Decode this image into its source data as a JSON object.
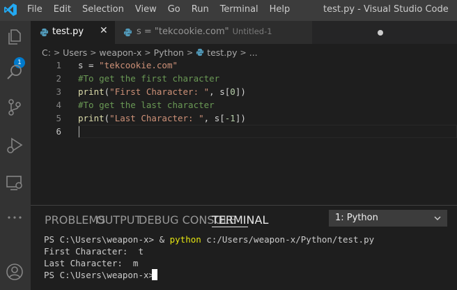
{
  "window": {
    "title": "test.py - Visual Studio Code"
  },
  "menu": [
    "File",
    "Edit",
    "Selection",
    "View",
    "Go",
    "Run",
    "Terminal",
    "Help"
  ],
  "activity_bar": {
    "items": [
      "explorer-icon",
      "search-icon",
      "source-control-icon",
      "run-debug-icon",
      "remote-explorer-icon",
      "extensions-icon",
      "account-icon"
    ],
    "explorer_badge": "1"
  },
  "tabs": [
    {
      "label": "test.py",
      "active": true
    },
    {
      "label": "s = \"tekcookie.com\"",
      "sub": "Untitled-1",
      "active": false,
      "dirty": true
    }
  ],
  "breadcrumb": [
    "C:",
    "Users",
    "weapon-x",
    "Python",
    "test.py",
    "..."
  ],
  "editor": {
    "line_numbers": [
      "1",
      "2",
      "3",
      "4",
      "5",
      "6"
    ],
    "lines": [
      {
        "t1": "s = ",
        "t2": "\"tekcookie.com\""
      },
      {
        "t1": "#To get the first character"
      },
      {
        "t1": "print",
        "t2": "(",
        "t3": "\"First Character: \"",
        "t4": ", s[",
        "t5": "0",
        "t6": "])"
      },
      {
        "t1": "#To get the last character"
      },
      {
        "t1": "print",
        "t2": "(",
        "t3": "\"Last Character: \"",
        "t4": ", s[",
        "t5": "-1",
        "t6": "])"
      }
    ]
  },
  "panel": {
    "tabs": [
      "PROBLEMS",
      "OUTPUT",
      "DEBUG CONSOLE",
      "TERMINAL"
    ],
    "active_tab": "TERMINAL",
    "terminal_select": "1: Python",
    "terminal": {
      "prompt1": "PS C:\\Users\\weapon-x> & ",
      "cmd1": "python",
      "args1": " c:/Users/weapon-x/Python/test.py",
      "out1": "First Character:  t",
      "out2": "Last Character:  m",
      "prompt2": "PS C:\\Users\\weapon-x>"
    }
  },
  "colors": {
    "accent": "#007acc",
    "string": "#ce9178",
    "comment": "#6a9955",
    "function": "#dcdcaa",
    "number": "#b5cea8"
  }
}
